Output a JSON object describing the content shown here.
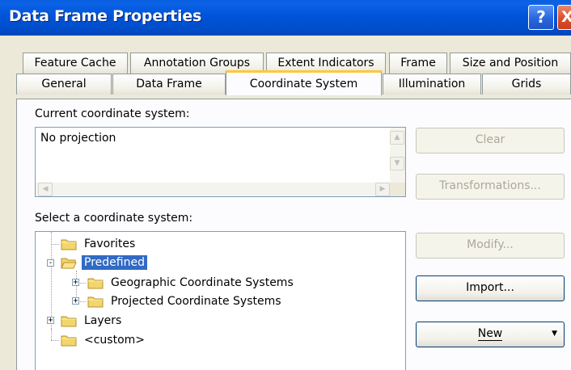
{
  "window": {
    "title": "Data Frame Properties",
    "help_label": "?",
    "close_label": "X"
  },
  "tabs_row1": [
    "Feature Cache",
    "Annotation Groups",
    "Extent Indicators",
    "Frame",
    "Size and Position"
  ],
  "tabs_row2": [
    "General",
    "Data Frame",
    "Coordinate System",
    "Illumination",
    "Grids"
  ],
  "active_tab": "Coordinate System",
  "current": {
    "label": "Current coordinate system:",
    "value": "No projection"
  },
  "select": {
    "label": "Select a coordinate system:"
  },
  "tree": [
    {
      "label": "Favorites",
      "level": 0,
      "expander": "",
      "selected": false,
      "open": false
    },
    {
      "label": "Predefined",
      "level": 0,
      "expander": "-",
      "selected": true,
      "open": true
    },
    {
      "label": "Geographic Coordinate Systems",
      "level": 1,
      "expander": "+",
      "selected": false,
      "open": false
    },
    {
      "label": "Projected Coordinate Systems",
      "level": 1,
      "expander": "+",
      "selected": false,
      "open": false
    },
    {
      "label": "Layers",
      "level": 0,
      "expander": "+",
      "selected": false,
      "open": false
    },
    {
      "label": "<custom>",
      "level": 0,
      "expander": "",
      "selected": false,
      "open": false
    }
  ],
  "buttons": {
    "clear": "Clear",
    "transformations": "Transformations...",
    "modify": "Modify...",
    "import": "Import...",
    "new": "New"
  },
  "colors": {
    "titlebar": "#0054d8",
    "selection": "#316ac5",
    "active_tab_accent": "#ffc83c"
  },
  "icons": {
    "folder": "folder-icon",
    "folder_open": "folder-open-icon",
    "dropdown": "dropdown-arrow-icon"
  }
}
